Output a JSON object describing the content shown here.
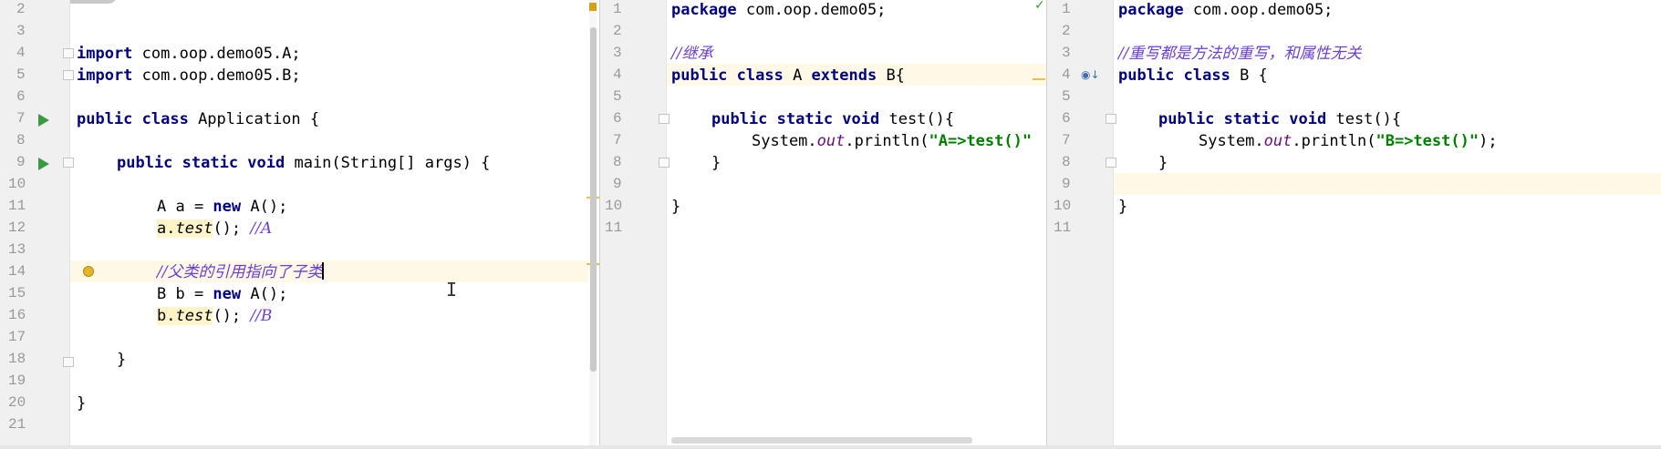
{
  "panes": [
    {
      "line_numbers": [
        "2",
        "3",
        "4",
        "5",
        "6",
        "7",
        "8",
        "9",
        "10",
        "11",
        "12",
        "13",
        "14",
        "15",
        "16",
        "17",
        "18",
        "19",
        "20",
        "21"
      ],
      "lines": {
        "l4_kw": "import",
        "l4_rest": " com.oop.demo05.A;",
        "l5_kw": "import",
        "l5_rest": " com.oop.demo05.B;",
        "l7_kw": "public class",
        "l7_rest": " Application {",
        "l9_kw": "public static void",
        "l9_rest": " main(String[] args) {",
        "l11_a": "A a = ",
        "l11_kw": "new",
        "l11_b": " A();",
        "l12_var": "a.",
        "l12_method": "test",
        "l12_rest": "(); ",
        "l12_comment": "//A",
        "l14_comment": "//父类的引用指向了子类",
        "l15_a": "B b = ",
        "l15_kw": "new",
        "l15_b": " A();",
        "l16_var": "b.",
        "l16_method": "test",
        "l16_rest": "(); ",
        "l16_comment": "//B",
        "l18": "}",
        "l20": "}"
      }
    },
    {
      "line_numbers": [
        "1",
        "2",
        "3",
        "4",
        "5",
        "6",
        "7",
        "8",
        "9",
        "10",
        "11"
      ],
      "lines": {
        "l1_kw": "package",
        "l1_rest": " com.oop.demo05;",
        "l3_comment": "//继承",
        "l4_kw1": "public class",
        "l4_cls": " A ",
        "l4_kw2": "extends",
        "l4_rest": " B{",
        "l6_kw": "public static void",
        "l6_rest": " test(){",
        "l7_a": "System.",
        "l7_field": "out",
        "l7_b": ".println(",
        "l7_str": "\"A=>test()\"",
        "l8": "}",
        "l10": "}"
      }
    },
    {
      "line_numbers": [
        "1",
        "2",
        "3",
        "4",
        "5",
        "6",
        "7",
        "8",
        "9",
        "10",
        "11"
      ],
      "lines": {
        "l1_kw": "package",
        "l1_rest": " com.oop.demo05;",
        "l3_comment": "//重写都是方法的重写，和属性无关",
        "l4_kw": "public class",
        "l4_rest": " B {",
        "l6_kw": "public static void",
        "l6_rest": " test(){",
        "l7_a": "System.",
        "l7_field": "out",
        "l7_b": ".println(",
        "l7_str": "\"B=>test()\"",
        "l7_c": ");",
        "l8": "}",
        "l10": "}"
      }
    }
  ],
  "colors": {
    "keyword": "#000080",
    "string": "#008000",
    "comment": "#6b3fd6",
    "field": "#660e7a",
    "current_line": "#fdf9e6",
    "usage_highlight": "#fff3c8"
  },
  "icons": [
    "run-icon",
    "fold-icon",
    "bulb-icon",
    "override-icon",
    "check-icon",
    "warning-icon",
    "text-cursor-icon"
  ]
}
